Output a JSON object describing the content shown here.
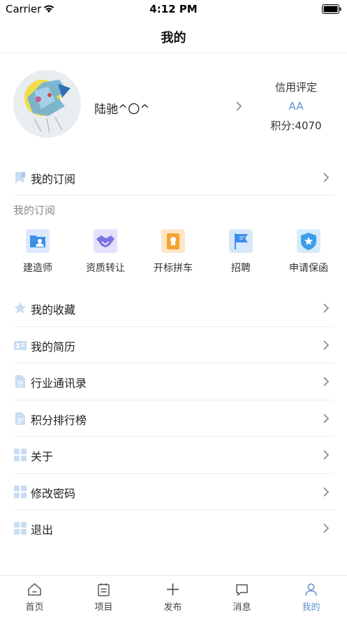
{
  "status_bar": {
    "carrier": "Carrier",
    "time": "4:12 PM",
    "icons": [
      "wifi-icon",
      "battery-icon"
    ]
  },
  "header": {
    "title": "我的"
  },
  "profile": {
    "name": "陆驰^〇^",
    "credit_title": "信用评定",
    "credit_grade": "AA",
    "credit_points": "积分:4070",
    "grade_color": "#5e8fd0"
  },
  "subscription": {
    "row_label": "我的订阅",
    "section_label": "我的订阅",
    "items": [
      {
        "label": "建造师",
        "icon": "architect-card-icon",
        "color": "#3d8ee8"
      },
      {
        "label": "资质转让",
        "icon": "handshake-icon",
        "color": "#7a73e6"
      },
      {
        "label": "开标拼车",
        "icon": "certificate-icon",
        "color": "#f5a233"
      },
      {
        "label": "招聘",
        "icon": "recruit-flag-icon",
        "color": "#3d8ee8"
      },
      {
        "label": "申请保函",
        "icon": "shield-star-icon",
        "color": "#3d9ee8"
      }
    ]
  },
  "menu": [
    {
      "label": "我的收藏",
      "icon": "star-icon"
    },
    {
      "label": "我的简历",
      "icon": "resume-card-icon"
    },
    {
      "label": "行业通讯录",
      "icon": "document-icon"
    },
    {
      "label": "积分排行榜",
      "icon": "document-icon"
    },
    {
      "label": "关于",
      "icon": "grid-icon"
    },
    {
      "label": "修改密码",
      "icon": "grid-icon"
    },
    {
      "label": "退出",
      "icon": "grid-icon"
    }
  ],
  "tab_bar": [
    {
      "label": "首页",
      "icon": "home-icon"
    },
    {
      "label": "项目",
      "icon": "clipboard-icon"
    },
    {
      "label": "发布",
      "icon": "plus-icon"
    },
    {
      "label": "消息",
      "icon": "message-icon"
    },
    {
      "label": "我的",
      "icon": "user-icon"
    }
  ],
  "colors": {
    "accent": "#5e8fd0",
    "icon_light": "#c8dcf3",
    "divider": "#ececec"
  }
}
